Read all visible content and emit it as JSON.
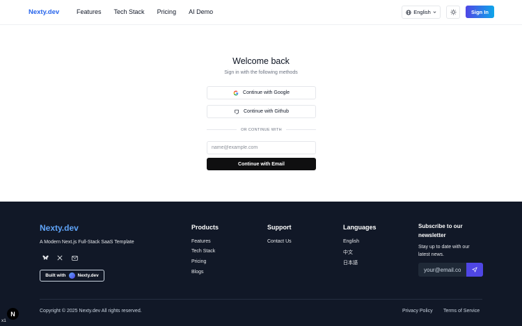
{
  "header": {
    "logo": "Nexty.dev",
    "nav": [
      "Features",
      "Tech Stack",
      "Pricing",
      "AI Demo"
    ],
    "language": "English",
    "signin": "Sign In"
  },
  "auth": {
    "title": "Welcome back",
    "subtitle": "Sign in with the following methods",
    "google": "Continue with Google",
    "github": "Continue with Github",
    "divider": "OR CONTINUE WITH",
    "email_placeholder": "name@example.com",
    "email_button": "Continue with Email"
  },
  "footer": {
    "logo": "Nexty.dev",
    "tagline": "A Modern Next.js Full-Stack SaaS Template",
    "built_prefix": "Built with",
    "built_name": "Nexty.dev",
    "products": {
      "heading": "Products",
      "links": [
        "Features",
        "Tech Stack",
        "Pricing",
        "Blogs"
      ]
    },
    "support": {
      "heading": "Support",
      "links": [
        "Contact Us"
      ]
    },
    "languages": {
      "heading": "Languages",
      "links": [
        "English",
        "中文",
        "日本語"
      ]
    },
    "newsletter": {
      "heading": "Subscribe to our newsletter",
      "sub": "Stay up to date with our latest news.",
      "placeholder": "your@email.com"
    },
    "copyright": "Copyright © 2025 Nexty.dev All rights reserved.",
    "privacy": "Privacy Policy",
    "terms": "Terms of Service"
  },
  "badge": {
    "letter": "N",
    "corner": "x1"
  },
  "colors": {
    "brand": "#2563eb",
    "footer_bg": "#111827",
    "accent": "#4f46e5"
  }
}
